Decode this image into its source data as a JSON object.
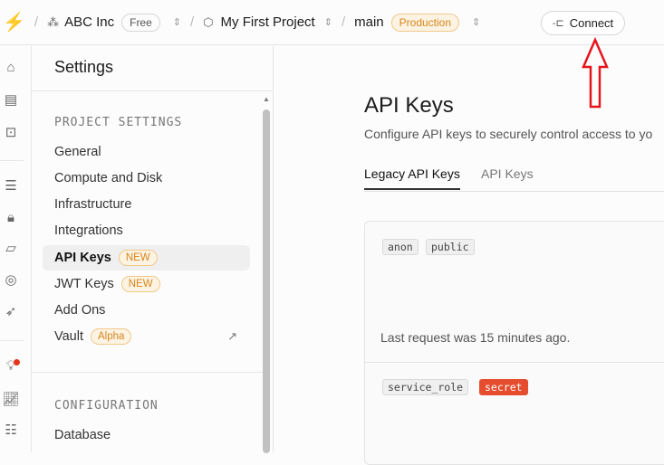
{
  "topbar": {
    "org": "ABC Inc",
    "plan": "Free",
    "project": "My First Project",
    "branch": "main",
    "env": "Production",
    "connect": "Connect"
  },
  "settings": {
    "title": "Settings",
    "section1": "PROJECT SETTINGS",
    "items": [
      {
        "label": "General"
      },
      {
        "label": "Compute and Disk"
      },
      {
        "label": "Infrastructure"
      },
      {
        "label": "Integrations"
      },
      {
        "label": "API Keys",
        "badge": "NEW"
      },
      {
        "label": "JWT Keys",
        "badge": "NEW"
      },
      {
        "label": "Add Ons"
      },
      {
        "label": "Vault",
        "badge": "Alpha"
      }
    ],
    "section2": "CONFIGURATION",
    "config_items": [
      {
        "label": "Database"
      }
    ]
  },
  "main": {
    "title": "API Keys",
    "description": "Configure API keys to securely control access to yo",
    "tabs": [
      {
        "label": "Legacy API Keys"
      },
      {
        "label": "API Keys"
      }
    ],
    "anon_key": {
      "role": "anon",
      "tag": "public",
      "last_request": "Last request was 15 minutes ago."
    },
    "service_key": {
      "role": "service_role",
      "tag": "secret"
    }
  },
  "colors": {
    "accent": "#3ecf8e",
    "secret": "#e54d2e",
    "badge": "#d6861b"
  }
}
